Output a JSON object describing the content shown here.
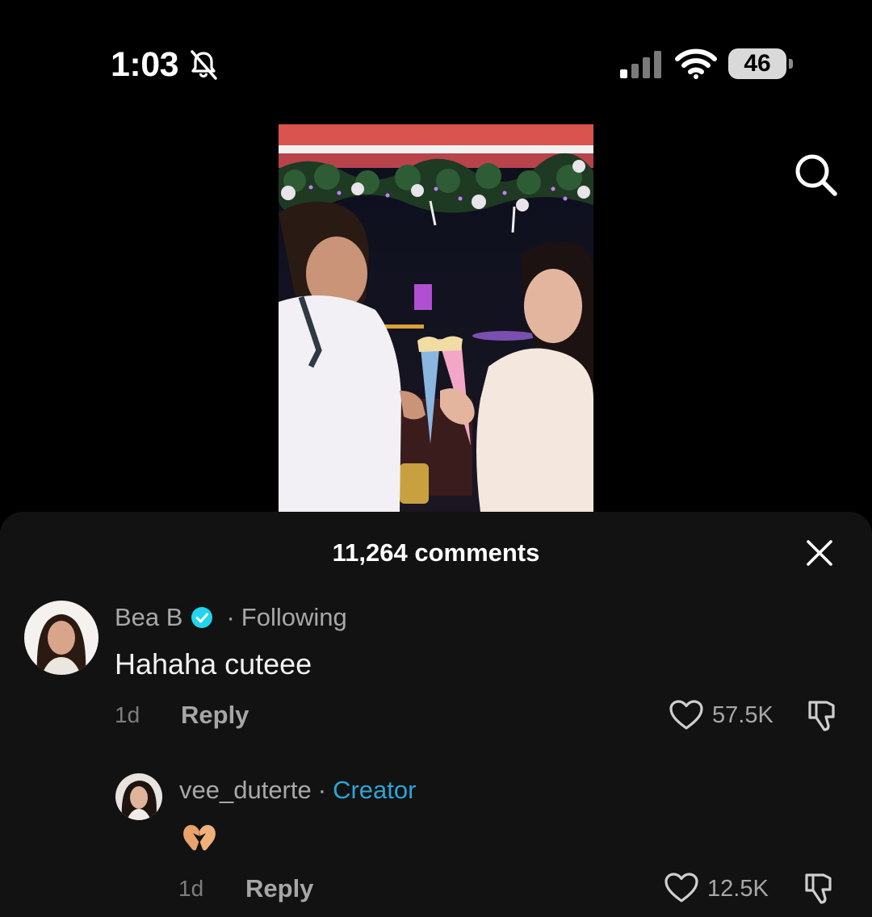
{
  "status_bar": {
    "time": "1:03",
    "battery_level": "46",
    "icons": [
      "bell-slash-icon",
      "cellular-signal-icon",
      "wifi-icon",
      "battery-icon"
    ]
  },
  "header": {
    "search_icon": "search-icon"
  },
  "comments_sheet": {
    "title": "11,264 comments",
    "close_icon": "close-icon",
    "comments": [
      {
        "username": "Bea B",
        "verified": true,
        "relation": "Following",
        "text": "Hahaha cuteee",
        "age": "1d",
        "reply_label": "Reply",
        "likes": "57.5K"
      },
      {
        "username": "vee_duterte",
        "badge": "Creator",
        "text_emoji": "heart-hands-emoji",
        "age": "1d",
        "reply_label": "Reply",
        "likes": "12.5K"
      }
    ]
  },
  "colors": {
    "sheet_bg": "#121212",
    "creator_badge": "#2ea3d6",
    "verified_badge": "#20d5ec"
  }
}
